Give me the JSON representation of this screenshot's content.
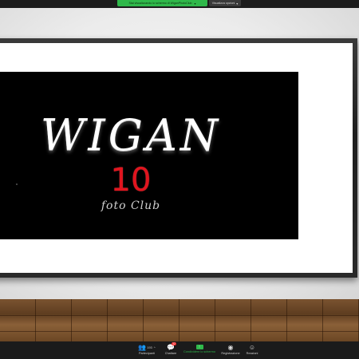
{
  "top_bar": {
    "share_notice": "Stai visualizzando lo schermo di WiganPhotoClub",
    "share_notice_caret": "▾",
    "view_options": "Visualizza opzioni",
    "view_options_caret": "▾"
  },
  "shared_content": {
    "logo": {
      "title": "WIGAN",
      "number": "10",
      "subtitle": "foto Club"
    }
  },
  "toolbar": {
    "participants": {
      "icon": "participants-icon",
      "glyph": "👥",
      "count": "193",
      "caret": "^",
      "label": "Partecipanti"
    },
    "chat": {
      "icon": "chat-icon",
      "glyph": "💬",
      "badge": "32",
      "label": "Chattare"
    },
    "share": {
      "icon": "share-screen-icon",
      "glyph": "↑",
      "label": "Condividere lo schermo"
    },
    "record": {
      "icon": "record-icon",
      "glyph": "◉",
      "label": "Registrazione"
    },
    "reactions": {
      "icon": "reactions-icon",
      "glyph": "☺",
      "label": "Reazioni"
    }
  },
  "colors": {
    "share_green": "#2fb84a",
    "logo_red": "#e1141e",
    "toolbar_bg": "#1b1b1b"
  }
}
